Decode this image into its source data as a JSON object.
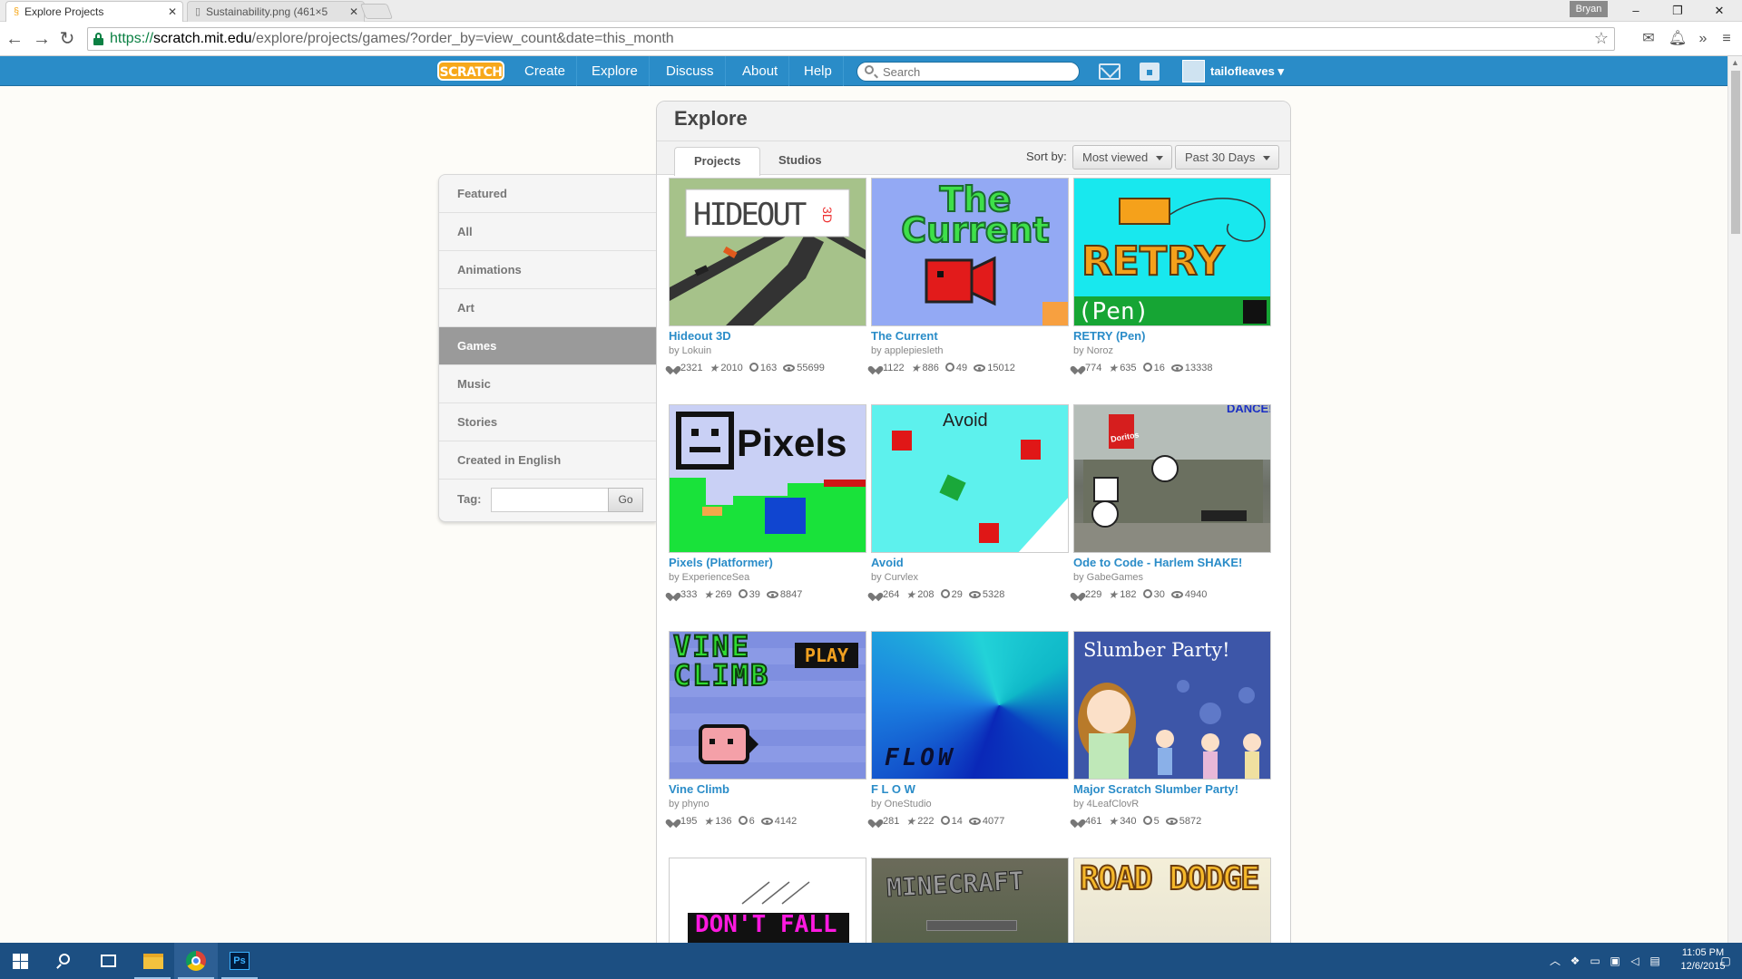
{
  "browser": {
    "tabs": [
      {
        "title": "Explore Projects",
        "active": true
      },
      {
        "title": "Sustainability.png (461×5",
        "active": false
      }
    ],
    "user_badge": "Bryan",
    "window_controls": {
      "minimize": "–",
      "restore": "❐",
      "close": "✕"
    },
    "url": {
      "scheme": "https://",
      "host": "scratch.mit.edu",
      "path": "/explore/projects/games/?order_by=view_count&date=this_month"
    }
  },
  "header": {
    "logo": "SCRATCH",
    "nav": [
      "Create",
      "Explore",
      "Discuss",
      "About",
      "Help"
    ],
    "search_placeholder": "Search",
    "username": "tailofleaves"
  },
  "sidebar": {
    "items": [
      "Featured",
      "All",
      "Animations",
      "Art",
      "Games",
      "Music",
      "Stories",
      "Created in English"
    ],
    "active_item": "Games",
    "tag_label": "Tag:",
    "tag_value": "",
    "go_label": "Go"
  },
  "explore": {
    "title": "Explore",
    "tabs": [
      "Projects",
      "Studios"
    ],
    "active_tab": "Projects",
    "sort_label": "Sort by:",
    "sort_value": "Most viewed",
    "date_value": "Past 30 Days"
  },
  "projects": [
    {
      "title": "Hideout 3D",
      "author": "by Lokuin",
      "loves": "2321",
      "favorites": "2010",
      "remixes": "163",
      "views": "55699"
    },
    {
      "title": "The Current",
      "author": "by applepiesleth",
      "loves": "1122",
      "favorites": "886",
      "remixes": "49",
      "views": "15012"
    },
    {
      "title": "RETRY (Pen)",
      "author": "by Noroz",
      "loves": "774",
      "favorites": "635",
      "remixes": "16",
      "views": "13338"
    },
    {
      "title": "Pixels (Platformer)",
      "author": "by ExperienceSea",
      "loves": "333",
      "favorites": "269",
      "remixes": "39",
      "views": "8847"
    },
    {
      "title": "Avoid",
      "author": "by Curvlex",
      "loves": "264",
      "favorites": "208",
      "remixes": "29",
      "views": "5328"
    },
    {
      "title": "Ode to Code - Harlem SHAKE!",
      "author": "by GabeGames",
      "loves": "229",
      "favorites": "182",
      "remixes": "30",
      "views": "4940"
    },
    {
      "title": "Vine Climb",
      "author": "by phyno",
      "loves": "195",
      "favorites": "136",
      "remixes": "6",
      "views": "4142"
    },
    {
      "title": "F L O W",
      "author": "by OneStudio",
      "loves": "281",
      "favorites": "222",
      "remixes": "14",
      "views": "4077"
    },
    {
      "title": "Major Scratch Slumber Party!",
      "author": "by 4LeafClovR",
      "loves": "461",
      "favorites": "340",
      "remixes": "5",
      "views": "5872"
    }
  ],
  "thumb_text": {
    "hideout": "HIDEOUT",
    "hideout_3d": "3D",
    "current": "The Current",
    "retry": "RETRY",
    "retry_pen": "(Pen)",
    "pixels": "Pixels",
    "avoid": "Avoid",
    "doritos": "Doritos",
    "dance": "DANCE!",
    "vine": "VINE",
    "climb": "CLIMB",
    "play": "PLAY",
    "flow": "FLOW",
    "slumber": "Slumber Party!",
    "dont_fall": "DON'T FALL",
    "minecraft": "MINECRAFT",
    "road_dodge": "ROAD DODGE"
  },
  "taskbar": {
    "time": "11:05 PM",
    "date": "12/6/2015",
    "ps_label": "Ps"
  },
  "colors": {
    "scratch_blue": "#2a8cc8",
    "link_blue": "#2a8cc8",
    "taskbar": "#1c4f82"
  }
}
